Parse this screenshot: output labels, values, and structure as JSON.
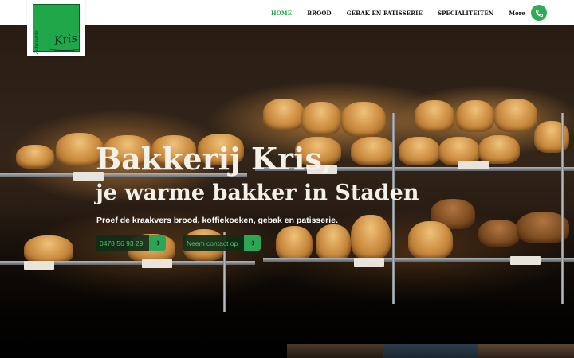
{
  "brand": {
    "logo_script": "Kris",
    "logo_side": "Patisserie"
  },
  "nav": {
    "items": [
      {
        "label": "HOME",
        "active": true
      },
      {
        "label": "BROOD",
        "active": false
      },
      {
        "label": "GEBAK EN PATISSERIE",
        "active": false
      },
      {
        "label": "SPECIALITEITEN",
        "active": false
      }
    ],
    "more_label": "More"
  },
  "hero": {
    "title_line1": "Bakkerij Kris,",
    "title_line2": "je warme bakker in Staden",
    "subtitle": "Proef de kraakvers brood, koffiekoeken, gebak en patisserie.",
    "phone_button": "0478 56 93 29",
    "contact_button": "Neem contact op"
  },
  "icons": {
    "phone": "phone-icon",
    "arrow": "arrow-right-icon"
  },
  "colors": {
    "accent": "#2faa57",
    "nav_active": "#23a24b",
    "cta_text": "#47c46d",
    "logo_green": "#1fa74a"
  }
}
